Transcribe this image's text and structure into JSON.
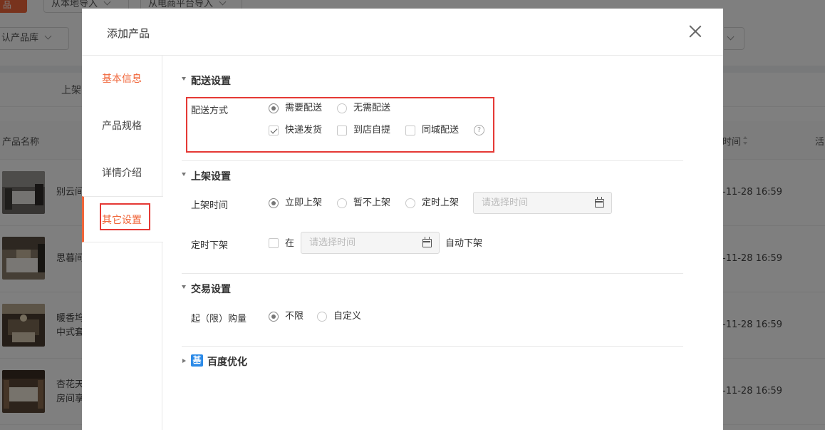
{
  "background": {
    "top_button_label": "品",
    "import_local_label": "从本地导入",
    "import_platform_label": "从电商平台导入",
    "library_select_label": "认产品库",
    "tab_on_shelf": "上架",
    "col_name": "产品名称",
    "col_time": "时间",
    "col_action": "活",
    "rows": [
      {
        "name_line1": "别云间",
        "name_line2": "",
        "time": "-11-28 16:59"
      },
      {
        "name_line1": "思暮间",
        "name_line2": "",
        "time": "-11-28 16:59"
      },
      {
        "name_line1": "暖香坞",
        "name_line2": "中式套",
        "time": "-11-28 16:59"
      },
      {
        "name_line1": "杏花天",
        "name_line2": "房间享",
        "time": "-11-28 16:59"
      }
    ]
  },
  "modal": {
    "title": "添加产品",
    "nav": [
      {
        "label": "基本信息"
      },
      {
        "label": "产品规格"
      },
      {
        "label": "详情介绍"
      },
      {
        "label": "其它设置"
      }
    ],
    "delivery": {
      "title": "配送设置",
      "method_label": "配送方式",
      "need_delivery": "需要配送",
      "no_delivery": "无需配送",
      "express": "快递发货",
      "pickup": "到店自提",
      "same_city": "同城配送",
      "help_glyph": "?"
    },
    "shelf": {
      "title": "上架设置",
      "time_label": "上架时间",
      "immediate": "立即上架",
      "not_now": "暂不上架",
      "scheduled": "定时上架",
      "time_placeholder": "请选择时间",
      "off_label": "定时下架",
      "at": "在",
      "off_placeholder": "请选择时间",
      "auto_off": "自动下架"
    },
    "trade": {
      "title": "交易设置",
      "limit_label": "起（限）购量",
      "unlimited": "不限",
      "custom": "自定义"
    },
    "baidu": {
      "title": "百度优化",
      "icon_glyph": "基"
    }
  }
}
